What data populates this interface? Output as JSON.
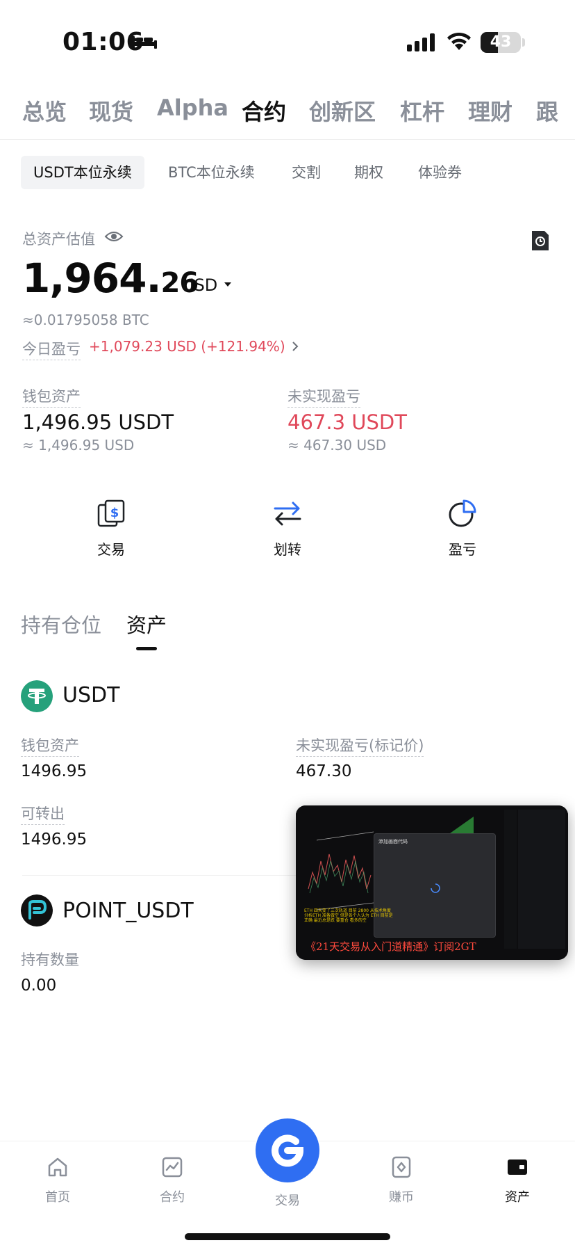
{
  "status_bar": {
    "time": "01:06",
    "battery": "43",
    "battery_level": 0.43
  },
  "main_tabs": [
    {
      "label": "总览",
      "active": false
    },
    {
      "label": "现货",
      "active": false
    },
    {
      "label": "Alpha",
      "active": false
    },
    {
      "label": "合约",
      "active": true
    },
    {
      "label": "创新区",
      "active": false
    },
    {
      "label": "杠杆",
      "active": false
    },
    {
      "label": "理财",
      "active": false
    },
    {
      "label": "跟",
      "active": false
    }
  ],
  "sub_tabs": [
    {
      "label": "USDT本位永续",
      "active": true
    },
    {
      "label": "BTC本位永续",
      "active": false
    },
    {
      "label": "交割",
      "active": false
    },
    {
      "label": "期权",
      "active": false
    },
    {
      "label": "体验券",
      "active": false
    }
  ],
  "summary": {
    "total_label": "总资产估值",
    "total_int": "1,964.",
    "total_dec": "26",
    "currency": "USD",
    "btc_value": "≈0.01795058 BTC",
    "pnl_label": "今日盈亏",
    "pnl_value": "+1,079.23 USD (+121.94%)",
    "wallet_label": "钱包资产",
    "wallet_value": "1,496.95 USDT",
    "wallet_approx": "≈ 1,496.95 USD",
    "unreal_label": "未实现盈亏",
    "unreal_value": "467.3 USDT",
    "unreal_approx": "≈ 467.30 USD"
  },
  "actions": [
    {
      "label": "交易",
      "icon": "dollar-card-icon"
    },
    {
      "label": "划转",
      "icon": "transfer-arrows-icon"
    },
    {
      "label": "盈亏",
      "icon": "pie-chart-icon"
    }
  ],
  "section_tabs": [
    {
      "label": "持有仓位",
      "active": false
    },
    {
      "label": "资产",
      "active": true
    }
  ],
  "assets": {
    "usdt": {
      "name": "USDT",
      "wallet_label": "钱包资产",
      "wallet_value": "1496.95",
      "unreal_label": "未实现盈亏(标记价)",
      "unreal_value": "467.30",
      "transferable_label": "可转出",
      "transferable_value": "1496.95"
    },
    "point": {
      "name": "POINT_USDT",
      "holding_label": "持有数量",
      "holding_value": "0.00"
    }
  },
  "pip_video": {
    "caption": "《21天交易从入门道精通》订阅2GT",
    "dialog_title": "添加画面代码",
    "overlay_text": "ETH 四天变了三次轨道 目前 2800 从技术角度分析ETH 准备做空 但是各个人认为 ETH 目前是正确 最近总是跌 要重仓 看多的空"
  },
  "bottom_nav": [
    {
      "label": "首页",
      "icon": "home-icon",
      "active": false
    },
    {
      "label": "合约",
      "icon": "futures-chart-icon",
      "active": false
    },
    {
      "label": "交易",
      "icon": "trade-logo-icon",
      "active": false
    },
    {
      "label": "赚币",
      "icon": "earn-diamond-icon",
      "active": false
    },
    {
      "label": "资产",
      "icon": "wallet-icon",
      "active": true
    }
  ],
  "colors": {
    "accent_blue": "#2f6ef2",
    "loss_red": "#e0485a",
    "muted_gray": "#8a8f99"
  }
}
